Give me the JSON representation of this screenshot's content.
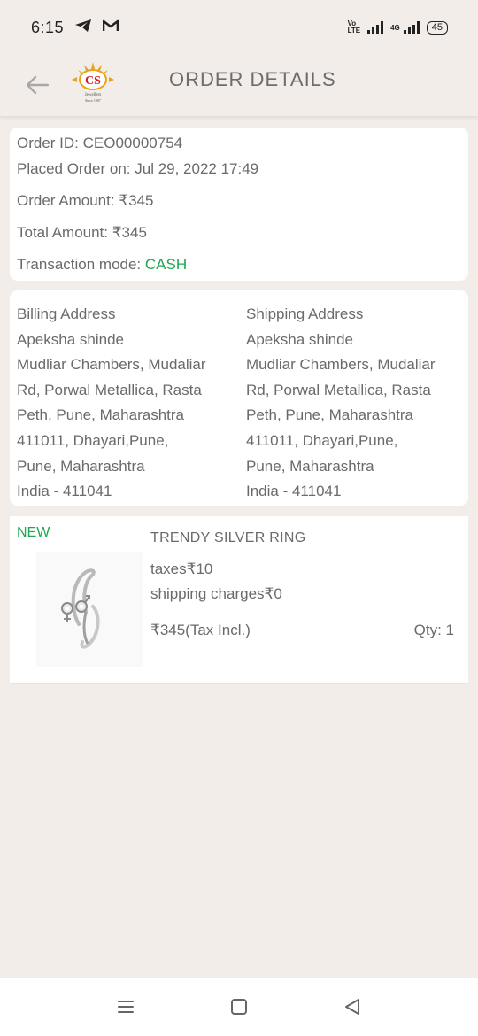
{
  "status_bar": {
    "time": "6:15",
    "icons": [
      "telegram-icon",
      "gmail-icon"
    ],
    "volte_top": "Vo",
    "volte_bottom": "LTE",
    "network": "4G",
    "battery": "45"
  },
  "header": {
    "title": "ORDER DETAILS",
    "logo_text": "CS",
    "logo_sub": "Jewellers",
    "logo_since": "Since 1907"
  },
  "order": {
    "order_id": "Order ID: CEO00000754",
    "placed_on": "Placed Order on: Jul 29, 2022 17:49",
    "order_amount": "Order Amount: ₹345",
    "total_amount": "Total Amount: ₹345",
    "transaction_label": "Transaction mode: ",
    "transaction_value": "CASH"
  },
  "billing": {
    "heading": "Billing Address",
    "lines": [
      "Apeksha shinde",
      "Mudliar Chambers, Mudaliar",
      "Rd, Porwal Metallica, Rasta",
      "Peth, Pune, Maharashtra",
      "411011, Dhayari,Pune,",
      "Pune, Maharashtra",
      "India - 411041"
    ]
  },
  "shipping": {
    "heading": "Shipping Address",
    "lines": [
      "Apeksha shinde",
      "Mudliar Chambers, Mudaliar",
      "Rd, Porwal Metallica, Rasta",
      "Peth, Pune, Maharashtra",
      "411011, Dhayari,Pune,",
      "Pune, Maharashtra",
      "India - 411041"
    ]
  },
  "item": {
    "badge": "NEW",
    "name": "TRENDY SILVER RING",
    "taxes": "taxes₹10",
    "shipping": "shipping charges₹0",
    "price": "₹345(Tax Incl.)",
    "qty": "Qty: 1"
  },
  "colors": {
    "background": "#f2ede9",
    "accent_green": "#1ea852",
    "logo_red": "#d0202e",
    "logo_gold": "#e8a21b"
  },
  "nav_icons": [
    "recent-apps-icon",
    "home-icon",
    "back-triangle-icon"
  ]
}
